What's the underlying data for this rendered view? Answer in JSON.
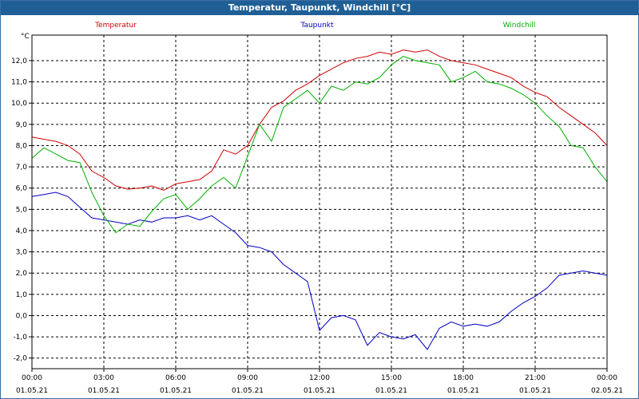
{
  "window": {
    "title": "Temperatur, Taupunkt, Windchill [°C]"
  },
  "chart_data": {
    "type": "line",
    "unit_label": "°C",
    "ylim": [
      -2.5,
      13.2
    ],
    "xlim": [
      0,
      24
    ],
    "grid": true,
    "legend_placement": "top",
    "y_ticks": [
      "-2,0",
      "-1,0",
      "0,0",
      "1,0",
      "2,0",
      "3,0",
      "4,0",
      "5,0",
      "6,0",
      "7,0",
      "8,0",
      "9,0",
      "10,0",
      "11,0",
      "12,0"
    ],
    "y_tick_values": [
      -2,
      -1,
      0,
      1,
      2,
      3,
      4,
      5,
      6,
      7,
      8,
      9,
      10,
      11,
      12
    ],
    "x_ticks": [
      {
        "time": "00:00",
        "date": "01.05.21",
        "hour": 0
      },
      {
        "time": "03:00",
        "date": "01.05.21",
        "hour": 3
      },
      {
        "time": "06:00",
        "date": "01.05.21",
        "hour": 6
      },
      {
        "time": "09:00",
        "date": "01.05.21",
        "hour": 9
      },
      {
        "time": "12:00",
        "date": "01.05.21",
        "hour": 12
      },
      {
        "time": "15:00",
        "date": "01.05.21",
        "hour": 15
      },
      {
        "time": "18:00",
        "date": "01.05.21",
        "hour": 18
      },
      {
        "time": "21:00",
        "date": "01.05.21",
        "hour": 21
      },
      {
        "time": "00:00",
        "date": "02.05.21",
        "hour": 24
      }
    ],
    "series": [
      {
        "name": "Temperatur",
        "color": "#d00000",
        "points": [
          [
            0,
            8.4
          ],
          [
            0.5,
            8.3
          ],
          [
            1,
            8.2
          ],
          [
            1.5,
            8.0
          ],
          [
            2,
            7.6
          ],
          [
            2.5,
            6.8
          ],
          [
            3,
            6.5
          ],
          [
            3.5,
            6.1
          ],
          [
            4,
            5.95
          ],
          [
            4.5,
            6.0
          ],
          [
            5,
            6.1
          ],
          [
            5.5,
            5.9
          ],
          [
            6,
            6.2
          ],
          [
            6.5,
            6.3
          ],
          [
            7,
            6.4
          ],
          [
            7.5,
            6.8
          ],
          [
            8,
            7.8
          ],
          [
            8.5,
            7.6
          ],
          [
            9,
            8.0
          ],
          [
            9.5,
            9.0
          ],
          [
            10,
            9.8
          ],
          [
            10.5,
            10.1
          ],
          [
            11,
            10.6
          ],
          [
            11.5,
            10.9
          ],
          [
            12,
            11.3
          ],
          [
            12.5,
            11.6
          ],
          [
            13,
            11.9
          ],
          [
            13.5,
            12.1
          ],
          [
            14,
            12.2
          ],
          [
            14.5,
            12.4
          ],
          [
            15,
            12.3
          ],
          [
            15.5,
            12.5
          ],
          [
            16,
            12.4
          ],
          [
            16.5,
            12.5
          ],
          [
            17,
            12.2
          ],
          [
            17.5,
            12.0
          ],
          [
            18,
            11.9
          ],
          [
            18.5,
            11.8
          ],
          [
            19,
            11.6
          ],
          [
            19.5,
            11.4
          ],
          [
            20,
            11.2
          ],
          [
            20.5,
            10.8
          ],
          [
            21,
            10.5
          ],
          [
            21.5,
            10.3
          ],
          [
            22,
            9.8
          ],
          [
            22.5,
            9.4
          ],
          [
            23,
            9.0
          ],
          [
            23.5,
            8.6
          ],
          [
            24,
            8.0
          ]
        ]
      },
      {
        "name": "Taupunkt",
        "color": "#0000c0",
        "points": [
          [
            0,
            5.6
          ],
          [
            0.5,
            5.7
          ],
          [
            1,
            5.8
          ],
          [
            1.5,
            5.6
          ],
          [
            2,
            5.1
          ],
          [
            2.5,
            4.6
          ],
          [
            3,
            4.5
          ],
          [
            3.5,
            4.4
          ],
          [
            4,
            4.3
          ],
          [
            4.5,
            4.5
          ],
          [
            5,
            4.4
          ],
          [
            5.5,
            4.6
          ],
          [
            6,
            4.6
          ],
          [
            6.5,
            4.7
          ],
          [
            7,
            4.5
          ],
          [
            7.5,
            4.7
          ],
          [
            8,
            4.3
          ],
          [
            8.5,
            3.9
          ],
          [
            9,
            3.3
          ],
          [
            9.5,
            3.2
          ],
          [
            10,
            3.0
          ],
          [
            10.5,
            2.4
          ],
          [
            11,
            2.0
          ],
          [
            11.5,
            1.6
          ],
          [
            12,
            -0.7
          ],
          [
            12.5,
            -0.1
          ],
          [
            13,
            0.0
          ],
          [
            13.5,
            -0.2
          ],
          [
            14,
            -1.4
          ],
          [
            14.5,
            -0.8
          ],
          [
            15,
            -1.0
          ],
          [
            15.5,
            -1.1
          ],
          [
            16,
            -0.9
          ],
          [
            16.5,
            -1.6
          ],
          [
            17,
            -0.6
          ],
          [
            17.5,
            -0.3
          ],
          [
            18,
            -0.5
          ],
          [
            18.5,
            -0.4
          ],
          [
            19,
            -0.5
          ],
          [
            19.5,
            -0.3
          ],
          [
            20,
            0.2
          ],
          [
            20.5,
            0.6
          ],
          [
            21,
            0.9
          ],
          [
            21.5,
            1.3
          ],
          [
            22,
            1.9
          ],
          [
            22.5,
            2.0
          ],
          [
            23,
            2.1
          ],
          [
            23.5,
            2.0
          ],
          [
            24,
            1.9
          ]
        ]
      },
      {
        "name": "Windchill",
        "color": "#00b000",
        "points": [
          [
            0,
            7.4
          ],
          [
            0.5,
            7.9
          ],
          [
            1,
            7.6
          ],
          [
            1.5,
            7.3
          ],
          [
            2,
            7.2
          ],
          [
            2.5,
            5.8
          ],
          [
            3,
            4.7
          ],
          [
            3.5,
            3.9
          ],
          [
            4,
            4.3
          ],
          [
            4.5,
            4.2
          ],
          [
            5,
            4.9
          ],
          [
            5.5,
            5.5
          ],
          [
            6,
            5.7
          ],
          [
            6.5,
            5.0
          ],
          [
            7,
            5.5
          ],
          [
            7.5,
            6.1
          ],
          [
            8,
            6.5
          ],
          [
            8.5,
            6.0
          ],
          [
            9,
            7.5
          ],
          [
            9.5,
            9.0
          ],
          [
            10,
            8.2
          ],
          [
            10.5,
            9.8
          ],
          [
            11,
            10.2
          ],
          [
            11.5,
            10.6
          ],
          [
            12,
            10.0
          ],
          [
            12.5,
            10.8
          ],
          [
            13,
            10.6
          ],
          [
            13.5,
            11.0
          ],
          [
            14,
            10.9
          ],
          [
            14.5,
            11.2
          ],
          [
            15,
            11.8
          ],
          [
            15.5,
            12.2
          ],
          [
            16,
            12.0
          ],
          [
            16.5,
            11.9
          ],
          [
            17,
            11.8
          ],
          [
            17.5,
            11.0
          ],
          [
            18,
            11.2
          ],
          [
            18.5,
            11.5
          ],
          [
            19,
            11.0
          ],
          [
            19.5,
            10.9
          ],
          [
            20,
            10.7
          ],
          [
            20.5,
            10.4
          ],
          [
            21,
            10.0
          ],
          [
            21.5,
            9.4
          ],
          [
            22,
            8.9
          ],
          [
            22.5,
            8.0
          ],
          [
            23,
            7.9
          ],
          [
            23.5,
            7.0
          ],
          [
            24,
            6.3
          ]
        ]
      }
    ]
  }
}
